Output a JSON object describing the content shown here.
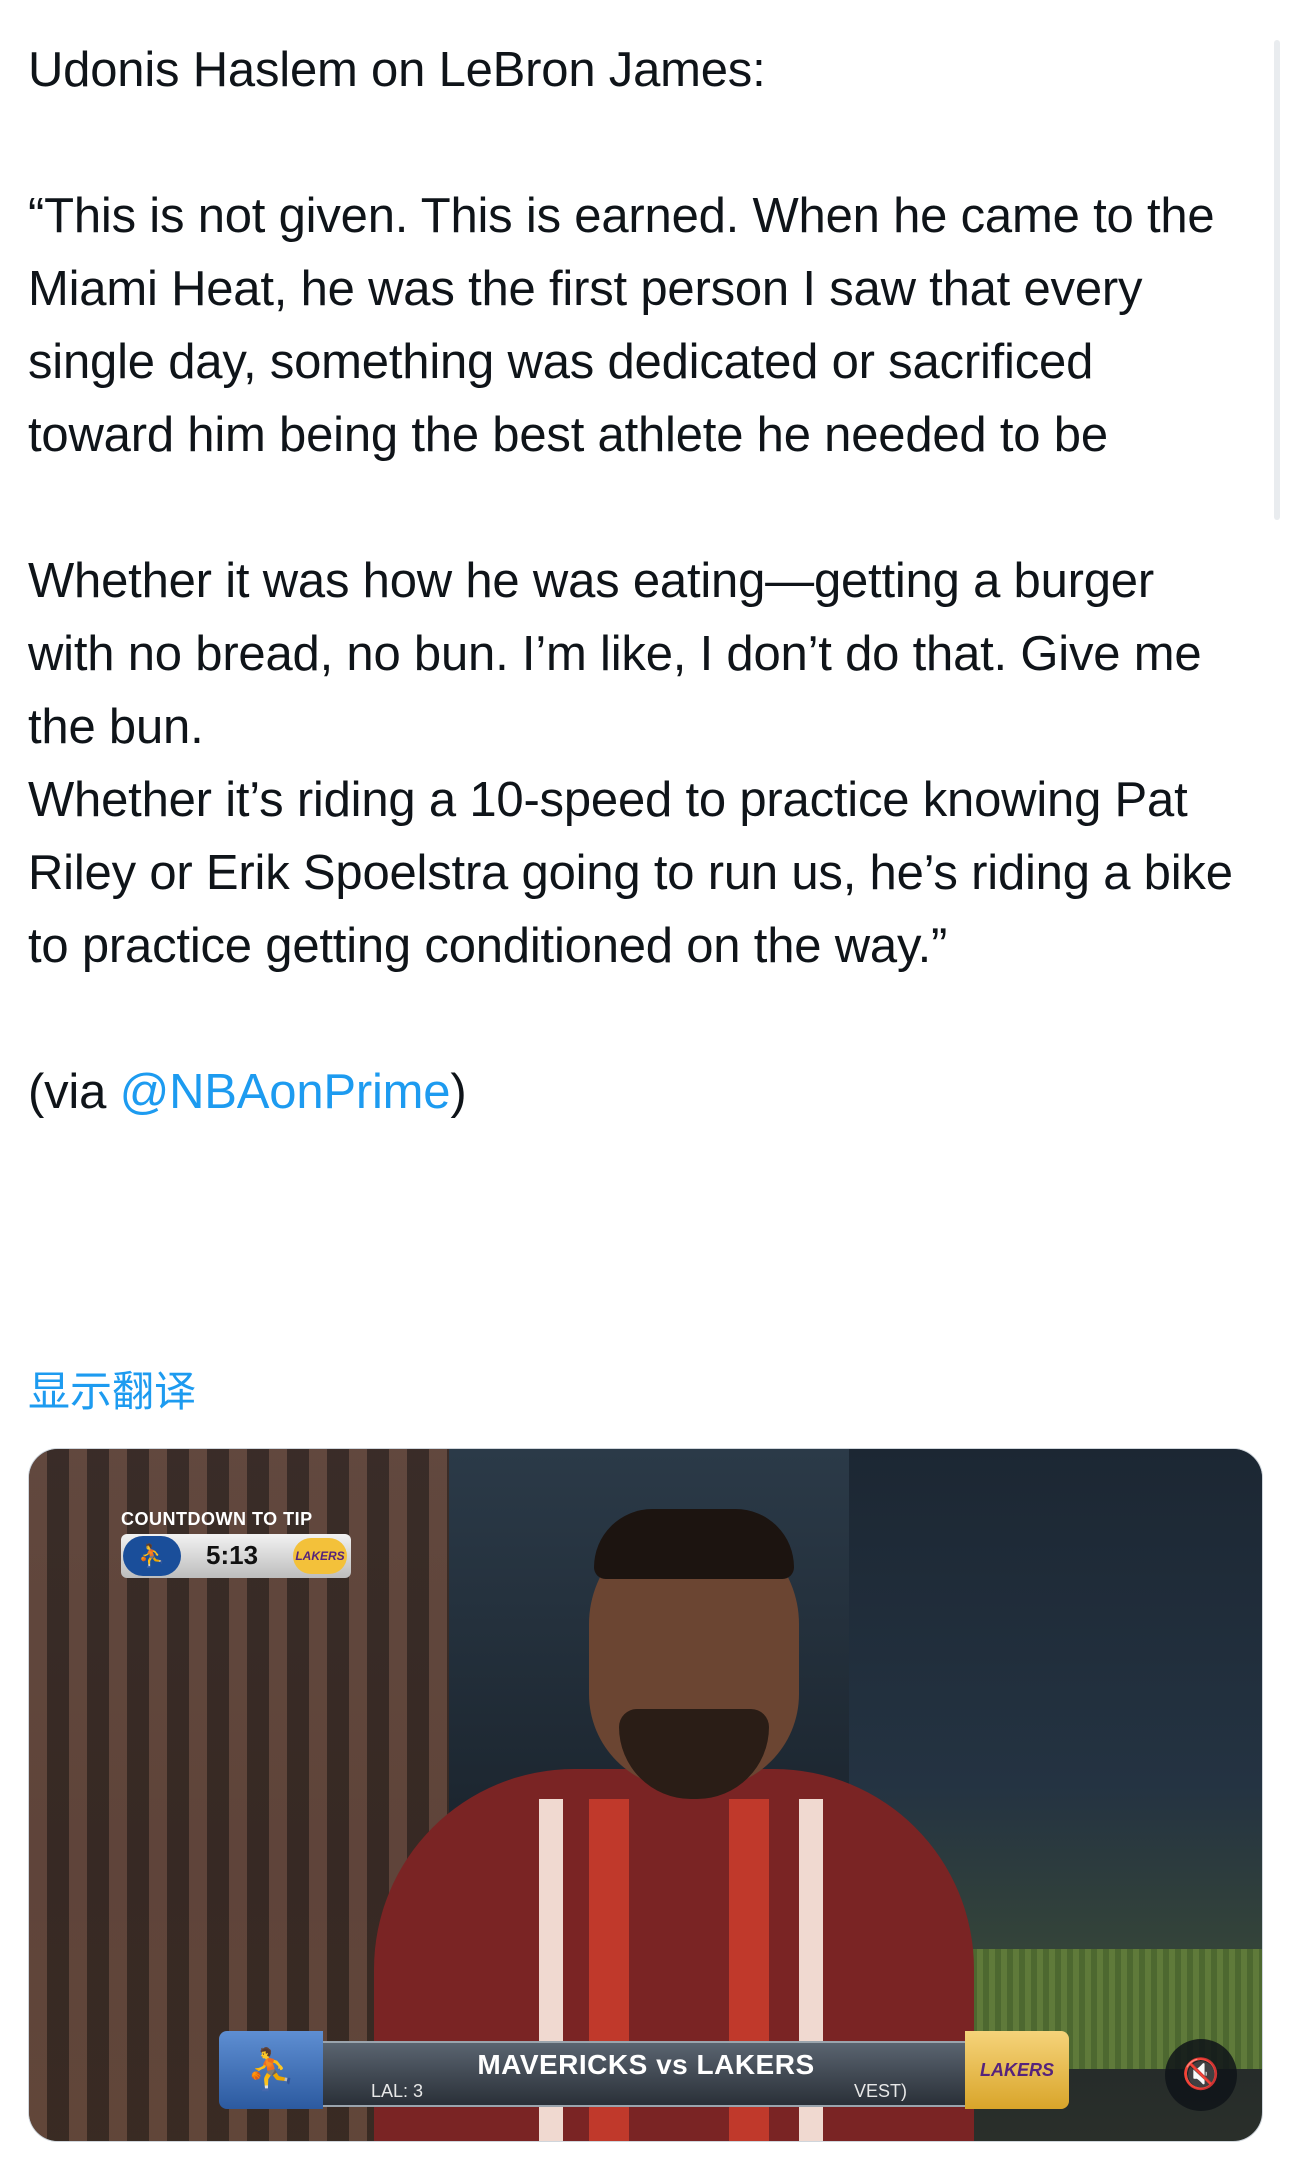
{
  "tweet": {
    "paragraphs": [
      "Udonis Haslem on LeBron James:",
      "“This is not given. This is earned. When he came to the Miami Heat, he was the first person I saw that every single day, something was dedicated or sacrificed toward him being the best athlete he needed to be",
      "Whether it was how he was eating—getting a burger with no bread, no bun. I’m like, I don’t do that. Give me the bun.",
      "Whether it’s riding a 10-speed to practice knowing Pat Riley or Erik Spoelstra going to run us, he’s riding a bike to practice getting conditioned on the way.”"
    ],
    "via_prefix": "(via ",
    "mention": "@NBAonPrime",
    "via_suffix": ")",
    "translate_label": "显示翻译",
    "mention_color": "#1d9bf0"
  },
  "media": {
    "countdown_label": "COUNTDOWN TO TIP",
    "countdown_time": "5:13",
    "mavs_logo_text": "⛹",
    "lakers_logo_text": "LAKERS",
    "lower_third_title": "MAVERICKS vs LAKERS",
    "lower_third_left": "LAL: 3",
    "lower_third_right": "VEST)",
    "mute_icon": "🔇",
    "jersey_colors": [
      "#7a2424",
      "#c0392b",
      "#f0d9d0"
    ]
  }
}
